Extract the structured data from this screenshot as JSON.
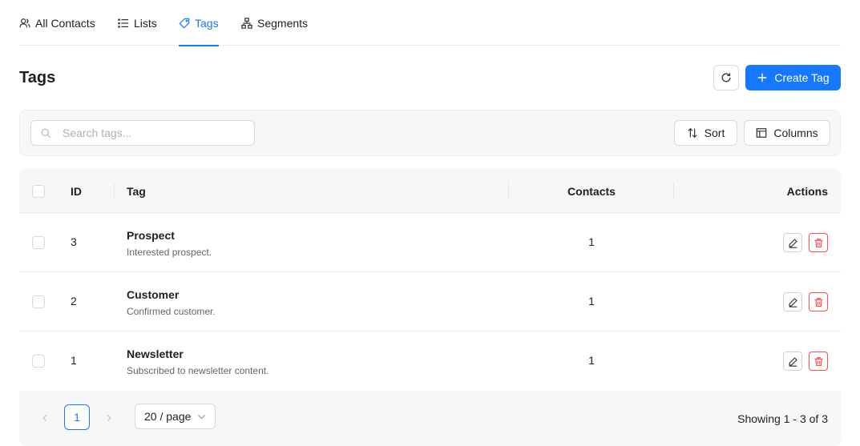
{
  "tabs": [
    {
      "label": "All Contacts",
      "icon": "contacts-icon",
      "active": false
    },
    {
      "label": "Lists",
      "icon": "list-icon",
      "active": false
    },
    {
      "label": "Tags",
      "icon": "tag-icon",
      "active": true
    },
    {
      "label": "Segments",
      "icon": "segments-icon",
      "active": false
    }
  ],
  "page": {
    "title": "Tags"
  },
  "actions": {
    "refresh_icon": "refresh-icon",
    "create_label": "Create Tag"
  },
  "toolbar": {
    "search_placeholder": "Search tags...",
    "sort_label": "Sort",
    "columns_label": "Columns"
  },
  "table": {
    "headers": {
      "id": "ID",
      "tag": "Tag",
      "contacts": "Contacts",
      "actions": "Actions"
    },
    "rows": [
      {
        "id": "3",
        "name": "Prospect",
        "description": "Interested prospect.",
        "contacts": "1"
      },
      {
        "id": "2",
        "name": "Customer",
        "description": "Confirmed customer.",
        "contacts": "1"
      },
      {
        "id": "1",
        "name": "Newsletter",
        "description": "Subscribed to newsletter content.",
        "contacts": "1"
      }
    ]
  },
  "pagination": {
    "current_page": "1",
    "page_size": "20 / page",
    "showing": "Showing 1 - 3 of 3"
  },
  "colors": {
    "accent": "#1677ff",
    "danger": "#ff4d4f"
  }
}
